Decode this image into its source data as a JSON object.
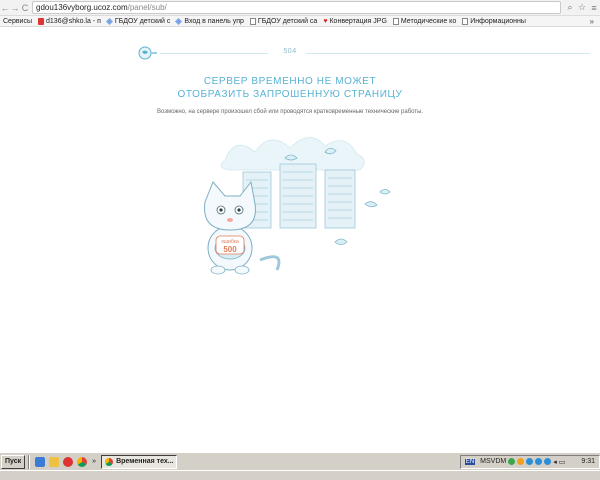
{
  "browser": {
    "url_host": "gdou136vyborg.ucoz.com",
    "url_path": "/panel/sub/",
    "nav_icons": [
      "back-icon",
      "forward-icon",
      "reload-icon"
    ],
    "bookmarks": [
      {
        "label": "Сервисы",
        "icon": "apps-icon"
      },
      {
        "label": "d136@shko.la - п",
        "icon": "gmail-icon"
      },
      {
        "label": "ГБДОУ детский с",
        "icon": "diamond-icon"
      },
      {
        "label": "Вход в панель упр",
        "icon": "diamond-icon"
      },
      {
        "label": "ГБДОУ детский са",
        "icon": "page-icon"
      },
      {
        "label": "Конвертация JPG",
        "icon": "heart-icon"
      },
      {
        "label": "Методические ко",
        "icon": "page-icon"
      },
      {
        "label": "Информационны",
        "icon": "page-icon"
      }
    ],
    "bookmarks_more": "»"
  },
  "page": {
    "code": "504",
    "title_line1": "СЕРВЕР ВРЕМЕННО НЕ МОЖЕТ",
    "title_line2": "ОТОБРАЗИТЬ ЗАПРОШЕННУЮ СТРАНИЦУ",
    "subtitle": "Возможно, на сервере произошел сбой или проводятся кратковременные технические работы.",
    "shirt_text_top": "ошибка",
    "shirt_text_bottom": "500",
    "accent_color": "#58b2d4"
  },
  "taskbar": {
    "start_label": "Пуск",
    "quick_more": "»",
    "task_label": "Временная тех...",
    "lang": "EN",
    "tray_text": "MSVDM",
    "clock": "9:31"
  }
}
